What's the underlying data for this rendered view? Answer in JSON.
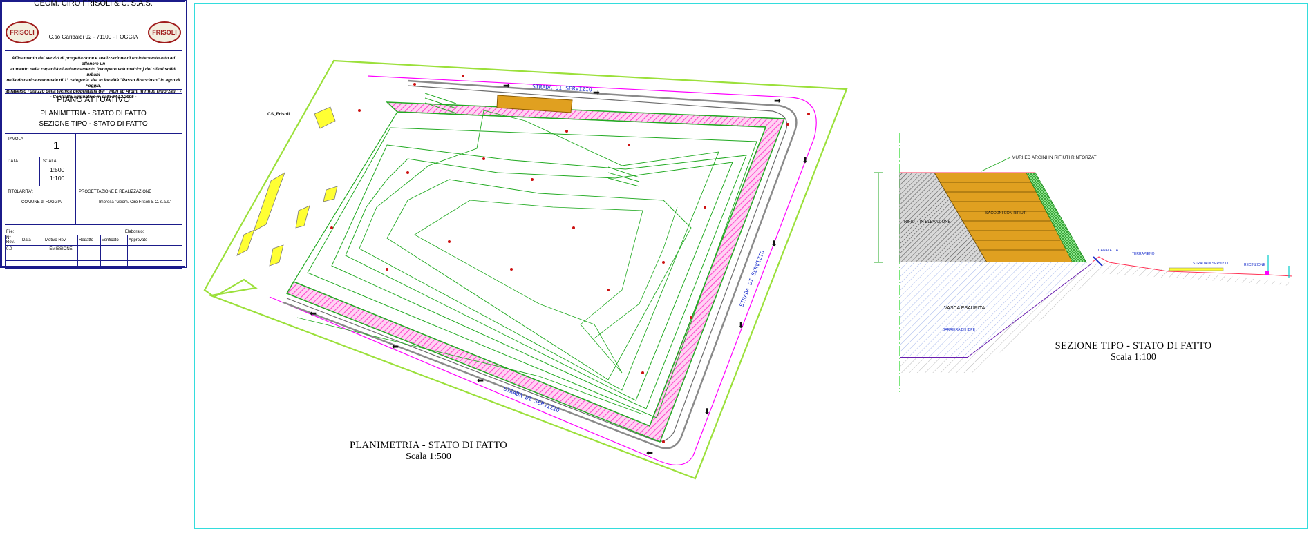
{
  "titleblock": {
    "company_name": "GEOM. CIRO FRISOLI & C. S.A.S.",
    "address": "C.so Garibaldi 92 - 71100 - FOGGIA",
    "logo_text": "FRISOLI",
    "description_lines": [
      "Affidamento dei servizi di progettazione e realizzazione di un intervento atto ad ottenere un",
      "aumento della capacità di abbancamento (recupero volumetrico) dei rifiuti solidi urbani",
      "nella discarica comunale di 1° categoria sita in località \"Passo Breccioso\" in agro di Foggia,",
      "attraverso l'utilizzo della tecnica proprietaria del \" Muri ed Argini in rifiuti rinforzati \" -",
      "- Contratto aggiuntivo in data 27.12.2005 -"
    ],
    "plan_title": "PIANO ATTUATIVO",
    "subtitle_1": "PLANIMETRIA - STATO DI FATTO",
    "subtitle_2": "SEZIONE TIPO - STATO DI FATTO",
    "tavola_label": "TAVOLA",
    "tavola_value": "1",
    "data_label": "DATA",
    "scala_label": "SCALA",
    "scala_1": "1:500",
    "scala_2": "1:100",
    "titolarita_label": "TITOLARITA':",
    "titolarita_value": "COMUNE di FOGGIA",
    "progettazione_label": "PROGETTAZIONE E REALIZZAZIONE :",
    "progettazione_value": "Impresa \"Geom. Ciro Frisoli & C. s.a.s.\"",
    "file_label": "File:",
    "elaborato_label": "Elaborato:",
    "revision_headers": [
      "N° Rev.",
      "Data",
      "Motivo Rev.",
      "Redatto",
      "Verificato",
      "Approvato"
    ],
    "revision_rows": [
      [
        "0.0",
        "",
        "EMISSIONE",
        "",
        "",
        ""
      ]
    ]
  },
  "plan": {
    "road_label_top": "STRADA DI SERVIZIO",
    "road_label_right": "STRADA DI SERVIZIO",
    "road_label_bottom": "STRADA DI SERVIZIO",
    "cs_label": "CS_Frisoli",
    "caption_title": "PLANIMETRIA - STATO DI FATTO",
    "caption_scale": "Scala 1:500"
  },
  "section": {
    "label_muri": "MURI ED ARGINI IN RIFIUTI RINFORZATI",
    "label_rifiuti": "RIFIUTI IN ELEVAZIONE",
    "label_sacconi": "SACCONI CON RIFIUTI",
    "label_vasca": "VASCA ESAURITA",
    "label_barriera": "BARRIERA DI HDPE",
    "label_canaletta": "CANALETTA",
    "label_terrapieno": "TERRAPIENO",
    "label_strada": "STRADA DI SERVIZIO",
    "label_recinzione": "RECINZIONE",
    "caption_title": "SEZIONE TIPO - STATO DI FATTO",
    "caption_scale": "Scala 1:100"
  },
  "colors": {
    "frame": "#33dddd",
    "green_line": "#22aa22",
    "magenta": "#ff00ff",
    "hatch_pink": "#ff66dd",
    "yellow": "#ffff33",
    "orange": "#e0a020",
    "blue_text": "#1a2fcc",
    "purple": "#6a1fb0"
  }
}
